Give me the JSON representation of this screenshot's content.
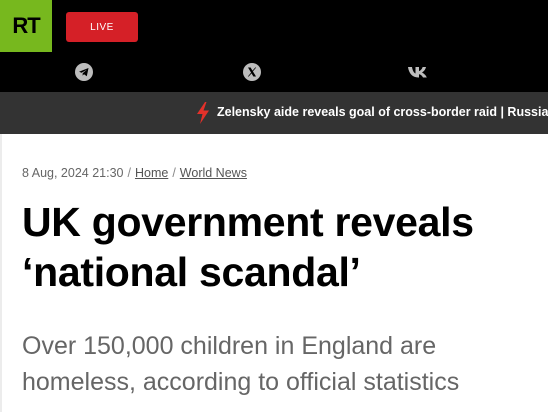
{
  "header": {
    "logo_text": "RT",
    "live_label": "LIVE",
    "brand_color": "#77b81e",
    "live_color": "#d52027",
    "socials": [
      {
        "icon": "telegram-icon"
      },
      {
        "icon": "x-icon"
      },
      {
        "icon": "vk-icon"
      }
    ]
  },
  "ticker": {
    "icon": "lightning-icon",
    "text": "Zelensky aide reveals goal of cross-border raid | Russia-"
  },
  "article": {
    "date": "8 Aug, 2024 21:30",
    "separator": "/",
    "breadcrumb": [
      "Home",
      "World News"
    ],
    "title": "UK government reveals ‘national scandal’",
    "summary": "Over 150,000 children in England are homeless, according to official statistics"
  }
}
